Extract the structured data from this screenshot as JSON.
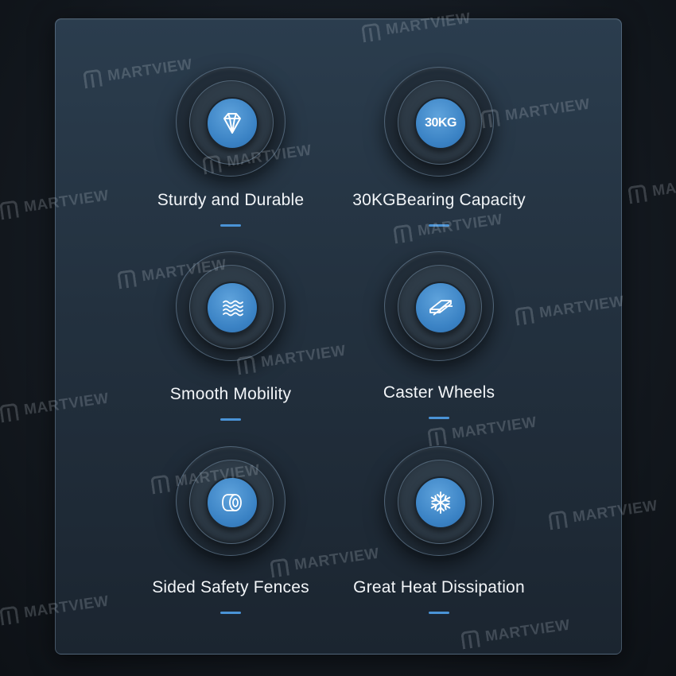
{
  "features": [
    {
      "label": "Sturdy and Durable",
      "icon": "diamond-icon"
    },
    {
      "label": "30KGBearing Capacity",
      "icon": "weight-badge-icon",
      "badge_text": "30KG"
    },
    {
      "label": "Smooth Mobility",
      "icon": "waves-icon"
    },
    {
      "label": "Caster Wheels",
      "icon": "caster-rails-icon"
    },
    {
      "label": "Sided Safety Fences",
      "icon": "cylinder-icon"
    },
    {
      "label": "Great Heat Dissipation",
      "icon": "snowflake-icon"
    }
  ],
  "watermark": {
    "text": "MARTVIEW"
  },
  "colors": {
    "accent": "#3a82c4",
    "panel": "#23313f",
    "background": "#12171d",
    "text": "#f2f5f8"
  }
}
